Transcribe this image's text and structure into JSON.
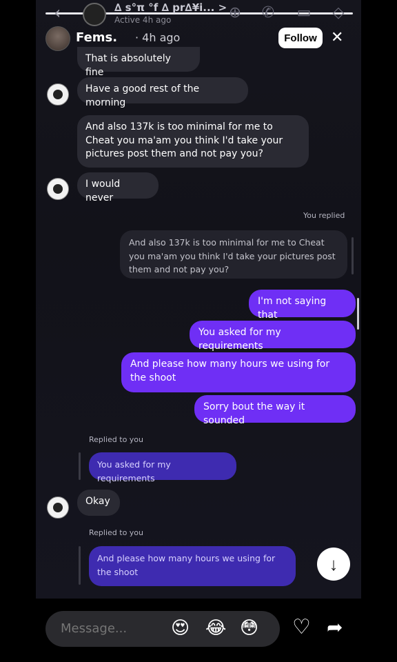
{
  "chat_header": {
    "name": "∆ s°π °f ∆ pr∆¥i... >",
    "status": "Active 4h ago"
  },
  "story": {
    "username": "Fems.",
    "time": "· 4h ago",
    "follow_label": "Follow"
  },
  "messages": {
    "m1": "That is absolutely fine",
    "m2": "Have a good rest of the morning",
    "m3": "And also 137k is too minimal for me to Cheat you ma'am you think I'd take your pictures post them and not pay you?",
    "m4": "I would never",
    "you_replied": "You replied",
    "quoted_self": "And also 137k is too minimal for me to Cheat you ma'am you think I'd take your pictures post them and not pay you?",
    "out1": "I'm not saying that",
    "out2": "You asked for my requirements",
    "out3": "And please how many hours we using for the shoot",
    "out4": "Sorry bout the way it sounded",
    "replied_to_you_1": "Replied to you",
    "quoted_out_1": "You asked for my requirements",
    "m5": "Okay",
    "replied_to_you_2": "Replied to you",
    "quoted_out_2": "And please how many hours we using for the shoot"
  },
  "composer": {
    "placeholder": "Message..."
  },
  "quick_reactions": [
    "😍",
    "😂",
    "😳"
  ],
  "icons": {
    "back": "‹",
    "close": "✕",
    "down": "↓",
    "heart": "♡",
    "share": "➦"
  }
}
